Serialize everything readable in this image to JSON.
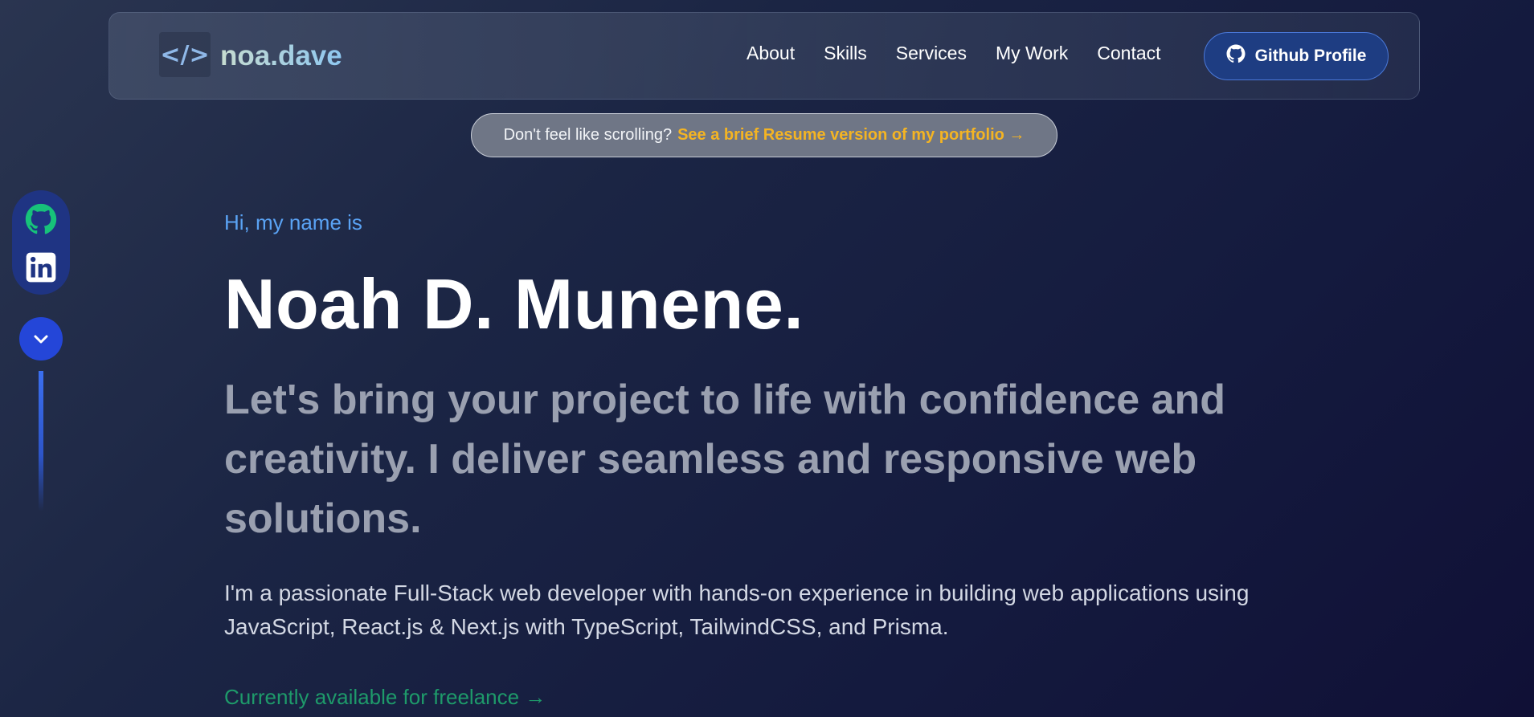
{
  "navbar": {
    "logo_icon": "</>",
    "logo_text": "noa.dave",
    "links": [
      "About",
      "Skills",
      "Services",
      "My Work",
      "Contact"
    ],
    "github_button": "Github Profile"
  },
  "banner": {
    "prefix": "Don't feel like scrolling?",
    "link": "See a brief Resume version of my portfolio →"
  },
  "social": {
    "icons": [
      "github-icon",
      "linkedin-icon"
    ],
    "scroll_icon": "chevron-down-icon",
    "github_color": "#17c27a"
  },
  "hero": {
    "greeting": "Hi, my name is",
    "name": "Noah D. Munene.",
    "tagline": "Let's bring your project to life with confidence and creativity. I deliver seamless and responsive web solutions.",
    "description": "I'm a passionate Full-Stack web developer with hands-on experience in building web applications using JavaScript, React.js & Next.js with TypeScript, TailwindCSS, and Prisma.",
    "freelance": "Currently available for freelance →"
  },
  "colors": {
    "accent_blue": "#5aa3f5",
    "accent_orange": "#f4b423",
    "accent_green": "#1e9a6a",
    "button_blue": "#1e3d82"
  }
}
